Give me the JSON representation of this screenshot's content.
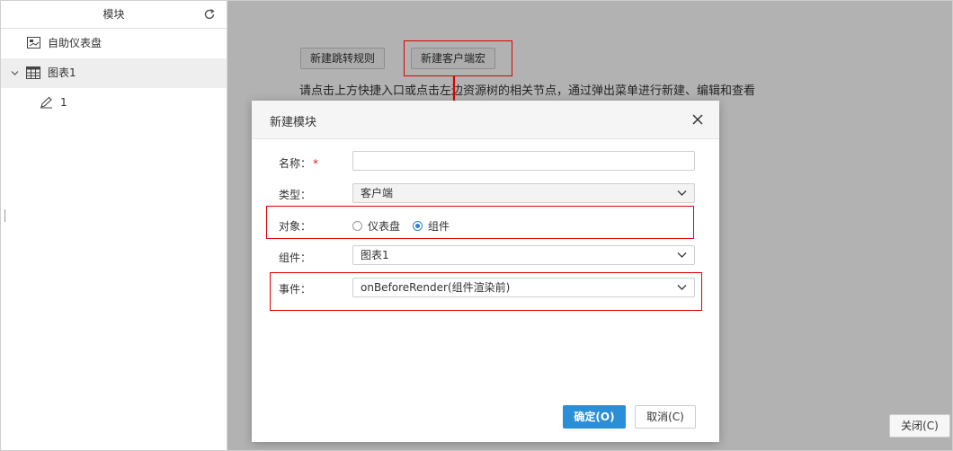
{
  "left_panel": {
    "title": "模块",
    "items": [
      {
        "label": "自助仪表盘",
        "icon": "dashboard-icon"
      },
      {
        "label": "图表1",
        "icon": "table-icon"
      },
      {
        "label": "1",
        "icon": "pen-icon"
      }
    ]
  },
  "toolbar": {
    "new_jump_rule": "新建跳转规则",
    "new_client_macro": "新建客户端宏"
  },
  "hint": "请点击上方快捷入口或点击左边资源树的相关节点，通过弹出菜单进行新建、编辑和查看",
  "dialog": {
    "title": "新建模块",
    "name_label": "名称：",
    "name_required": "*",
    "name_value": "",
    "type_label": "类型：",
    "type_value": "客户端",
    "object_label": "对象：",
    "object_options": [
      "仪表盘",
      "组件"
    ],
    "object_selected": "组件",
    "component_label": "组件：",
    "component_value": "图表1",
    "event_label": "事件：",
    "event_value": "onBeforeRender(组件渲染前)",
    "ok_label": "确定(O)",
    "cancel_label": "取消(C)"
  },
  "close_label": "关闭(C)",
  "colors": {
    "annotation_red": "#e00000",
    "primary_blue": "#2a8fd6",
    "radio_blue": "#2b7fd8"
  }
}
